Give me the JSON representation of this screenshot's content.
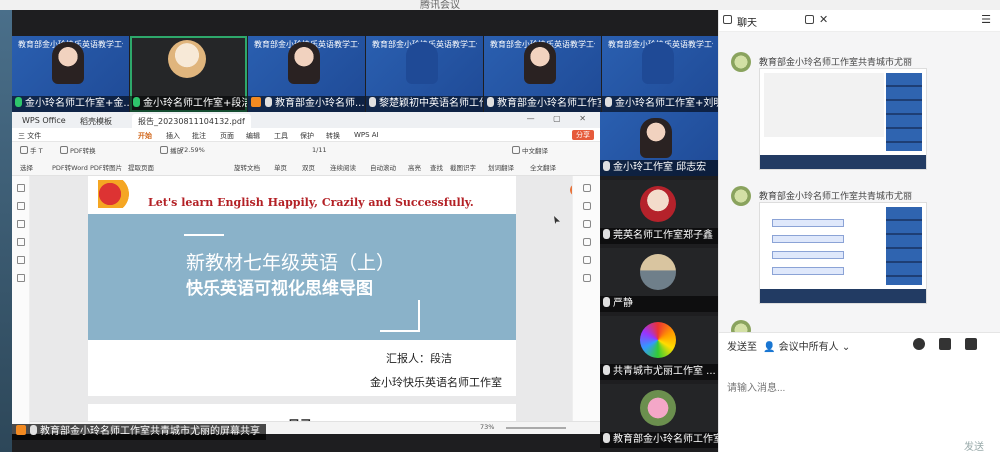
{
  "app": {
    "title": "腾讯会议"
  },
  "participants_top": [
    {
      "name": "金小玲名师工作室+金...",
      "mic": "on",
      "banner": "教育部金小玲快乐英语教学工作室"
    },
    {
      "name": "金小玲名师工作室+段洁",
      "mic": "on",
      "banner": ""
    },
    {
      "name": "教育部金小玲名师...",
      "mic": "off",
      "banner": "教育部金小玲快乐英语教学工作室"
    },
    {
      "name": "黎楚颖初中英语名师工作...",
      "mic": "off",
      "banner": "教育部金小玲快乐英语教学工作室"
    },
    {
      "name": "教育部金小玲名师工作室",
      "mic": "off",
      "banner": "教育部金小玲快乐英语教学工作室"
    },
    {
      "name": "金小玲名师工作室+刘明",
      "mic": "off",
      "banner": "教育部金小玲快乐英语教学工作室"
    }
  ],
  "participants_side": [
    {
      "name": "金小玲工作室 邱志宏",
      "mic": "off"
    },
    {
      "name": "莞英名师工作室郑子鑫",
      "mic": "off"
    },
    {
      "name": "严静",
      "mic": "off"
    },
    {
      "name": "共青城市尤丽工作室 ...",
      "mic": "off"
    },
    {
      "name": "教育部金小玲名师工作室",
      "mic": "off"
    }
  ],
  "screen_share": {
    "label": "教育部金小玲名师工作室共青城市尤丽的屏幕共享",
    "app_tabs": [
      "WPS Office",
      "稻壳模板",
      "报告_20230811104132.pdf"
    ],
    "menu": [
      "三 文件",
      "开始",
      "插入",
      "批注",
      "页面",
      "编辑",
      "工具",
      "保护",
      "转换",
      "WPS AI"
    ],
    "active_menu": "开始",
    "share_btn": "分享",
    "toolbar_row1": [
      "手 T",
      "PDF转换",
      "播放",
      "72.59%",
      "1/11",
      "中文翻译"
    ],
    "toolbar_row2": [
      "选择",
      "PDF转Word",
      "PDF转图片",
      "提取页面",
      "旋转文档",
      "单页",
      "双页",
      "连续阅读",
      "自动滚动",
      "高亮",
      "查找",
      "截图识字",
      "划词翻译",
      "全文翻译"
    ],
    "status": [
      "73%"
    ],
    "page_badge": "S",
    "doc": {
      "slogan": "Let's learn English Happily, Crazily and Successfully.",
      "title_line1": "新教材七年级英语（上）",
      "title_line2": "快乐英语可视化思维导图",
      "reporter": "汇报人：段洁",
      "studio": "金小玲快乐英语名师工作室",
      "toc": "目录"
    }
  },
  "chat": {
    "title": "聊天",
    "messages": [
      {
        "sender": "教育部金小玲名师工作室共青城市尤丽",
        "type": "image"
      },
      {
        "sender": "教育部金小玲名师工作室共青城市尤丽",
        "type": "image"
      }
    ],
    "send_to_label": "发送至",
    "send_to_value": "会议中所有人",
    "input_placeholder": "请输入消息...",
    "send_button": "发送"
  },
  "colors": {
    "accent": "#2ec56b",
    "share_orange": "#f28a21",
    "banner_blue": "#2a5fb0"
  }
}
